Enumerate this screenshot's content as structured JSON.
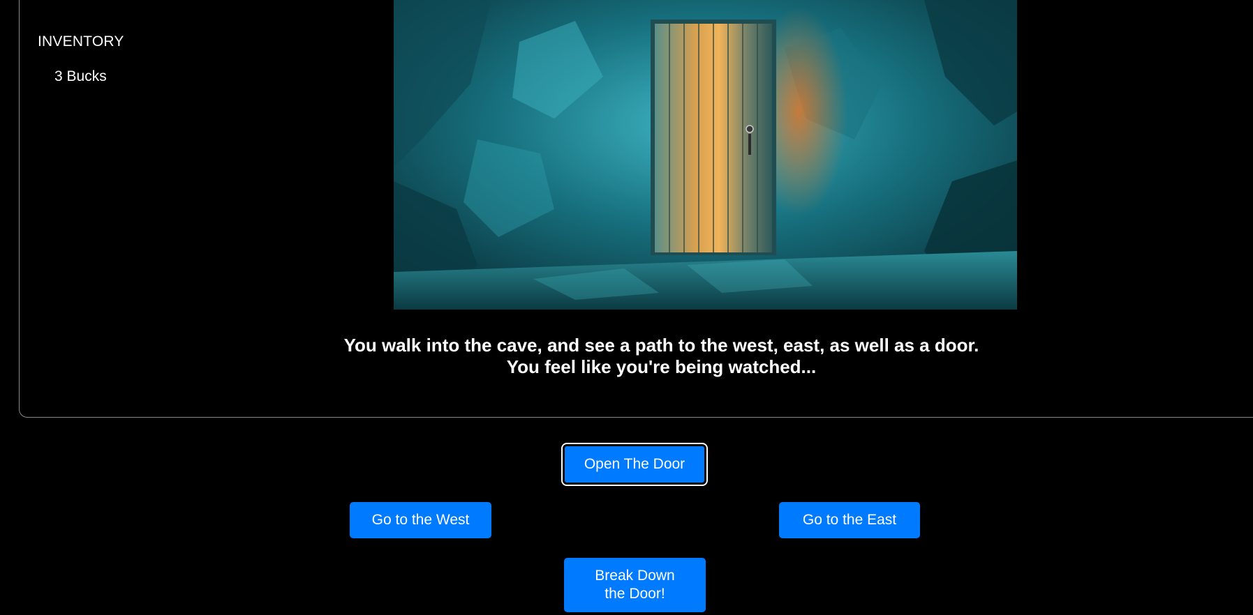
{
  "inventory": {
    "title": "INVENTORY",
    "items": [
      "3 Bucks"
    ]
  },
  "scene": {
    "image": "cave-door-image",
    "narration_line1": "You walk into the cave, and see a path to the west, east, as well as a door.",
    "narration_line2": "You feel like you're being watched..."
  },
  "actions": {
    "open_door": "Open The Door",
    "go_west": "Go to the West",
    "go_east": "Go to the East",
    "break_door": "Break Down the Door!"
  },
  "colors": {
    "background": "#000000",
    "button": "#007bff",
    "text": "#ffffff",
    "panel_border": "#8a8a8a"
  }
}
